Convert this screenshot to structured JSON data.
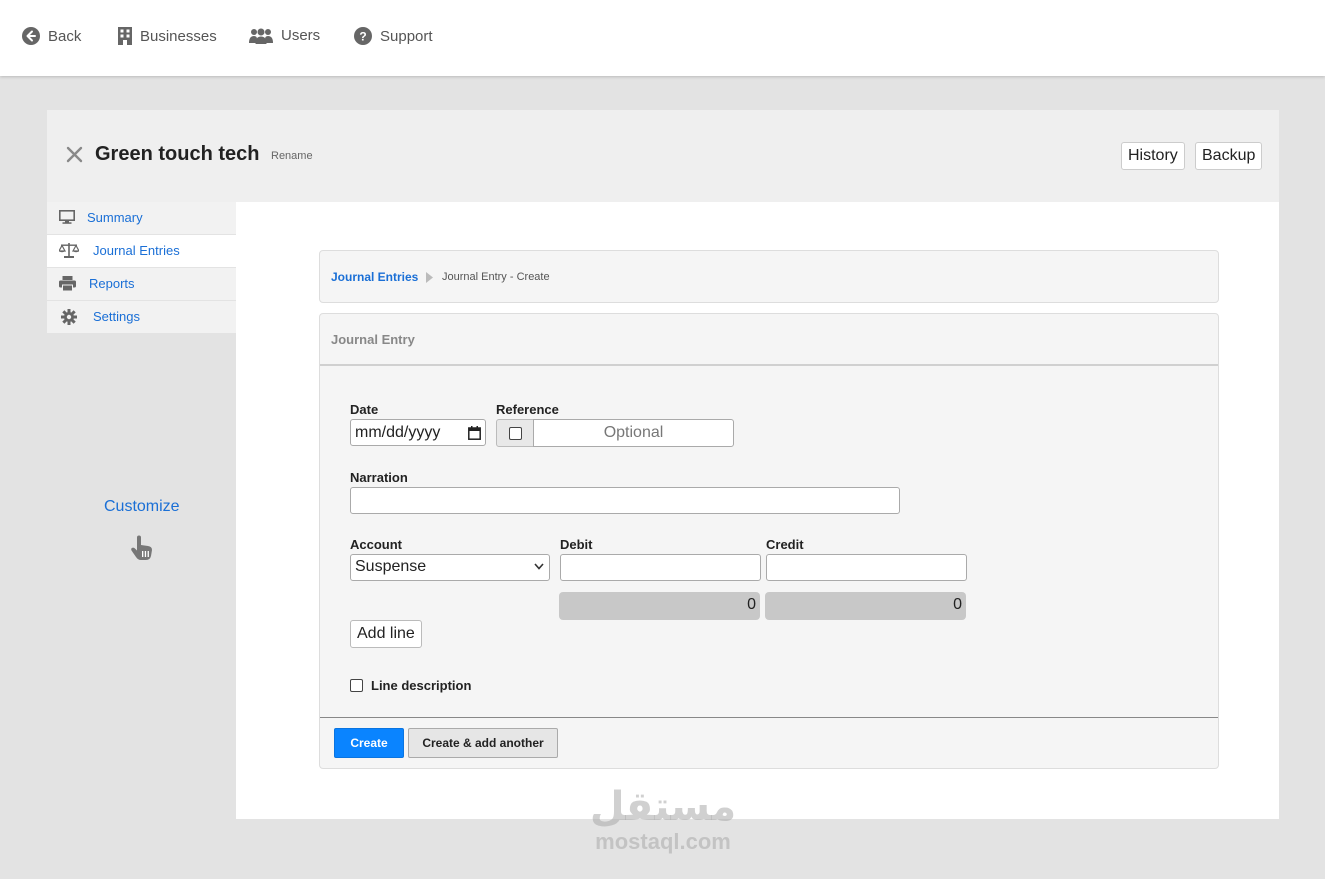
{
  "nav": {
    "back": "Back",
    "businesses": "Businesses",
    "users": "Users",
    "support": "Support"
  },
  "business": {
    "name": "Green touch tech",
    "rename": "Rename",
    "history": "History",
    "backup": "Backup"
  },
  "sidebar": {
    "items": [
      {
        "label": "Summary",
        "icon": "monitor-icon"
      },
      {
        "label": "Journal Entries",
        "icon": "scale-icon"
      },
      {
        "label": "Reports",
        "icon": "printer-icon"
      },
      {
        "label": "Settings",
        "icon": "gear-icon"
      }
    ],
    "active": "Journal Entries",
    "customize": "Customize"
  },
  "breadcrumb": {
    "parent": "Journal Entries",
    "current": "Journal Entry - Create"
  },
  "form": {
    "title": "Journal Entry",
    "date_label": "Date",
    "date_placeholder": "mm/dd/yyyy",
    "reference_label": "Reference",
    "reference_placeholder": "Optional",
    "narration_label": "Narration",
    "narration_value": "",
    "account_label": "Account",
    "account_value": "Suspense",
    "debit_label": "Debit",
    "credit_label": "Credit",
    "debit_value": "",
    "credit_value": "",
    "debit_total": "0",
    "credit_total": "0",
    "add_line": "Add line",
    "line_description": "Line description",
    "create": "Create",
    "create_add_another": "Create & add another"
  },
  "watermark": {
    "arabic": "مستقل",
    "latin": "mostaql.com"
  },
  "colors": {
    "link": "#1a6fd6",
    "primary_button": "#0a84ff",
    "background": "#e3e3e3"
  }
}
